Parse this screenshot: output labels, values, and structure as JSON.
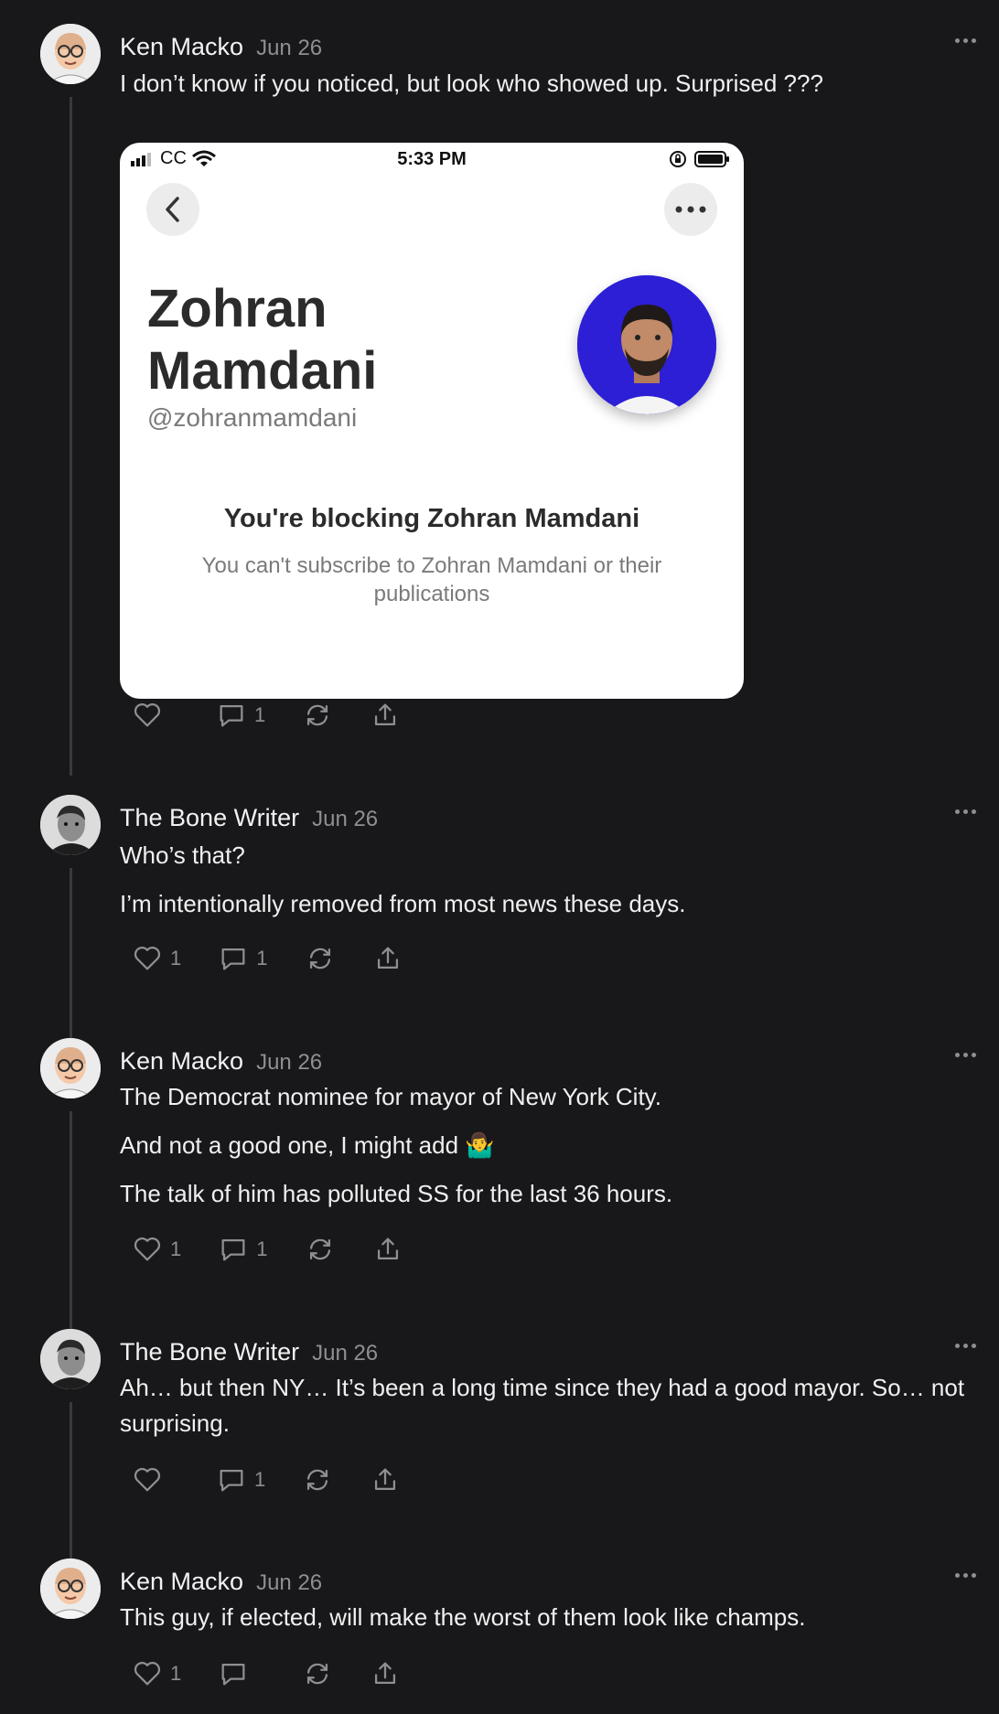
{
  "posts": [
    {
      "author": "Ken Macko",
      "date": "Jun 26",
      "paragraphs": [
        "I don’t know if you noticed, but look who showed up. Surprised ???"
      ],
      "likes": "",
      "comments": "1",
      "avatar": "cartoon-bald-glasses"
    },
    {
      "author": "The Bone Writer",
      "date": "Jun 26",
      "paragraphs": [
        "Who’s that?",
        "I’m intentionally removed from most news these days."
      ],
      "likes": "1",
      "comments": "1",
      "avatar": "bw-portrait"
    },
    {
      "author": "Ken Macko",
      "date": "Jun 26",
      "paragraphs": [
        "The Democrat nominee for mayor of New York City.",
        "And not a good one, I might add 🤷‍♂️",
        "The talk of him has polluted SS for the last 36 hours."
      ],
      "likes": "1",
      "comments": "1",
      "avatar": "cartoon-bald-glasses"
    },
    {
      "author": "The Bone Writer",
      "date": "Jun 26",
      "paragraphs": [
        "Ah… but then NY… It’s been a long time since they had a good mayor. So… not surprising."
      ],
      "likes": "",
      "comments": "1",
      "avatar": "bw-portrait"
    },
    {
      "author": "Ken Macko",
      "date": "Jun 26",
      "paragraphs": [
        "This guy, if elected, will make the worst of them look like champs."
      ],
      "likes": "1",
      "comments": "",
      "avatar": "cartoon-bald-glasses"
    }
  ],
  "embedded_screenshot": {
    "carrier": "CC",
    "time": "5:33 PM",
    "profile_name": "Zohran Mamdani",
    "handle": "@zohranmamdani",
    "block_title": "You're blocking Zohran Mamdani",
    "block_subtitle": "You can't subscribe to Zohran Mamdani or their publications",
    "profile_bg_color": "#2c1fd6"
  },
  "colors": {
    "background": "#18181b",
    "muted": "#8e8e93",
    "thread_line": "#3a3a3e"
  }
}
